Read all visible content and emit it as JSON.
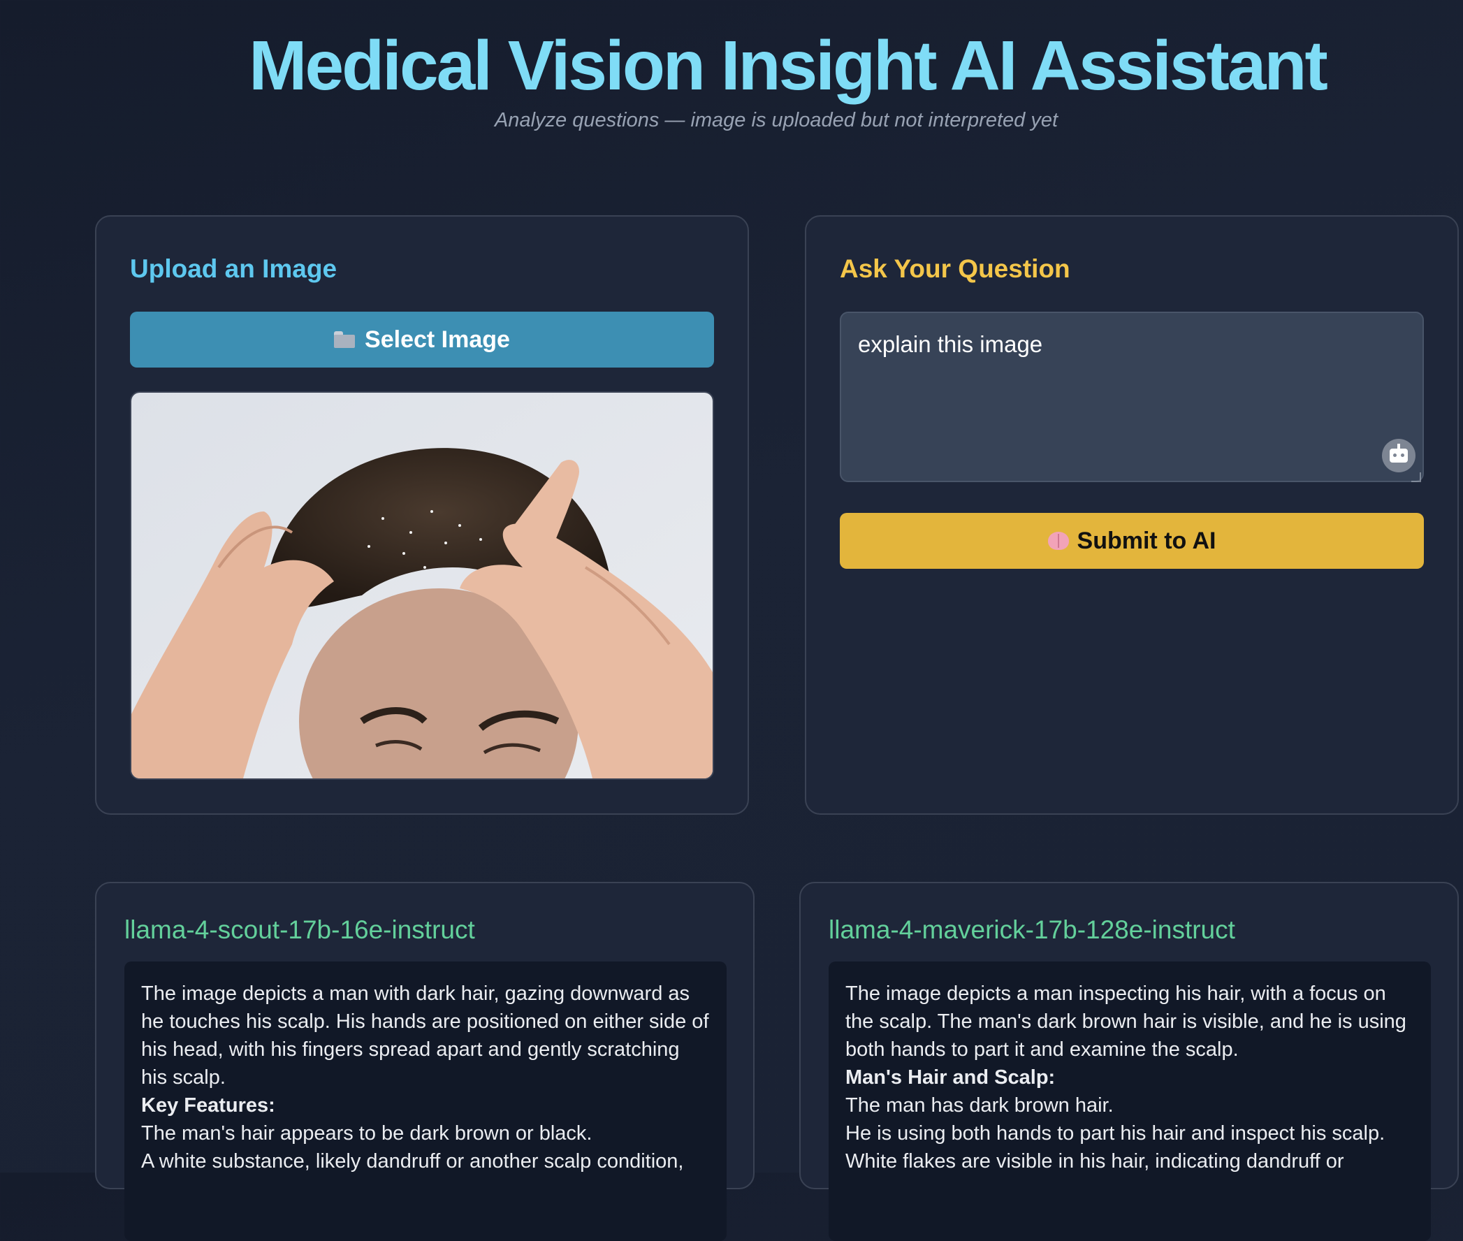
{
  "header": {
    "title": "Medical Vision Insight AI Assistant",
    "subtitle": "Analyze questions — image is uploaded but not interpreted yet"
  },
  "upload": {
    "heading": "Upload an Image",
    "select_button_label": "Select Image",
    "select_button_icon": "folder-icon",
    "preview_alt": "Uploaded image preview"
  },
  "ask": {
    "heading": "Ask Your Question",
    "question_value": "explain this image",
    "assist_icon": "robot-icon",
    "submit_button_label": "Submit to AI",
    "submit_button_icon": "brain-icon"
  },
  "results": [
    {
      "model": "llama-4-scout-17b-16e-instruct",
      "paragraphs": [
        "The image depicts a man with dark hair, gazing downward as he touches his scalp. His hands are positioned on either side of his head, with his fingers spread apart and gently scratching his scalp.",
        "Key Features:",
        "The man's hair appears to be dark brown or black.",
        "A white substance, likely dandruff or another scalp condition,"
      ]
    },
    {
      "model": "llama-4-maverick-17b-128e-instruct",
      "paragraphs": [
        "The image depicts a man inspecting his hair, with a focus on the scalp. The man's dark brown hair is visible, and he is using both hands to part it and examine the scalp.",
        "Man's Hair and Scalp:",
        "The man has dark brown hair.",
        "He is using both hands to part his hair and inspect his scalp.",
        "White flakes are visible in his hair, indicating dandruff or"
      ]
    }
  ],
  "colors": {
    "title": "#7fdcf6",
    "upload_heading": "#5ec8ef",
    "ask_heading": "#f4c64a",
    "model_heading": "#63d09b",
    "select_button": "#3d8fb3",
    "submit_button": "#e3b53c"
  }
}
